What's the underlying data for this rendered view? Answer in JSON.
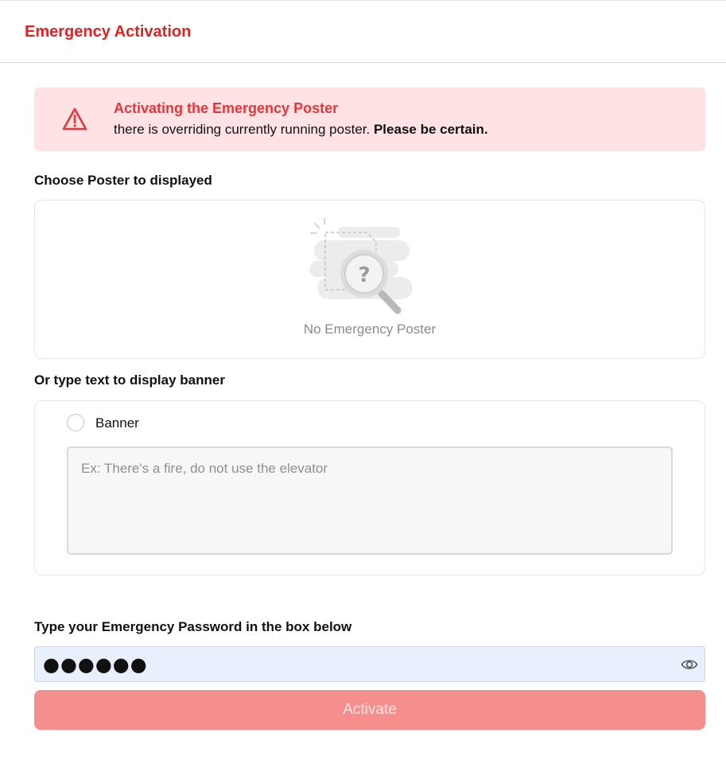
{
  "header": {
    "title": "Emergency Activation"
  },
  "alert": {
    "title": "Activating the Emergency Poster",
    "message": "there is overriding currently running poster.",
    "emphasis": "Please be certain.",
    "icon": "warning-triangle-icon"
  },
  "poster_section": {
    "label": "Choose Poster to displayed",
    "empty_text": "No Emergency Poster",
    "empty_icon": "magnifier-question-icon"
  },
  "banner_section": {
    "label": "Or type text to display banner",
    "option_label": "Banner",
    "placeholder": "Ex: There's a fire, do not use the elevator",
    "value": ""
  },
  "password_section": {
    "label": "Type your Emergency Password in the box below",
    "masked_value": "●●●●●●",
    "toggle_icon": "eye-icon"
  },
  "activate_button": {
    "label": "Activate"
  },
  "colors": {
    "accent": "#e32222",
    "alert_bg": "#ffe3e4",
    "button_bg": "#f58e8d",
    "input_bg": "#e8f0fd"
  }
}
